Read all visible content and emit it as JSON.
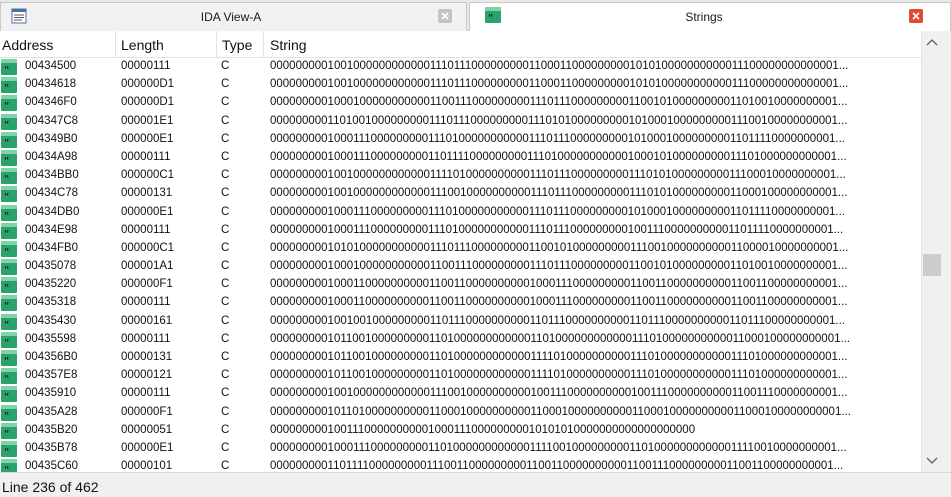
{
  "tabs": [
    {
      "title": "IDA View-A",
      "icon": "text-lines-icon",
      "active": false
    },
    {
      "title": "Strings",
      "icon": "quote-icon",
      "active": true
    }
  ],
  "columns": {
    "address": "Address",
    "length": "Length",
    "type": "Type",
    "string": "String"
  },
  "rows": [
    {
      "address": "00434500",
      "length": "00000111",
      "type": "C",
      "string": "000000000100100000000000011101110000000001100011000000000101010000000000011100000000000001..."
    },
    {
      "address": "00434618",
      "length": "000000D1",
      "type": "C",
      "string": "000000000100100000000000011101110000000001100011000000000101010000000000011100000000000001..."
    },
    {
      "address": "004346F0",
      "length": "000000D1",
      "type": "C",
      "string": "000000000100010000000000011001110000000001110111000000000110010100000000011010010000000001..."
    },
    {
      "address": "004347C8",
      "length": "000001E1",
      "type": "C",
      "string": "000000000110100100000000011101110000000001110101000000000101000100000000011100100000000001..."
    },
    {
      "address": "004349B0",
      "length": "000000E1",
      "type": "C",
      "string": "000000000100011100000000011101000000000001110111000000000101000100000000011011110000000001..."
    },
    {
      "address": "00434A98",
      "length": "00000111",
      "type": "C",
      "string": "000000000100011100000000011011110000000001110100000000000100010100000000011101000000000001..."
    },
    {
      "address": "00434BB0",
      "length": "000000C1",
      "type": "C",
      "string": "000000000100100000000000011110100000000001110111000000000111010100000000011100010000000001..."
    },
    {
      "address": "00434C78",
      "length": "00000131",
      "type": "C",
      "string": "000000000100100000000000011100100000000001110111000000000111010100000000011000100000000001..."
    },
    {
      "address": "00434DB0",
      "length": "000000E1",
      "type": "C",
      "string": "000000000100011100000000011101000000000001110111000000000101000100000000011011110000000001..."
    },
    {
      "address": "00434E98",
      "length": "00000111",
      "type": "C",
      "string": "000000000100011100000000011101000000000001110111000000000100111000000000011011110000000001..."
    },
    {
      "address": "00434FB0",
      "length": "000000C1",
      "type": "C",
      "string": "000000000101010000000000011101110000000001100101000000000111001000000000011000010000000001..."
    },
    {
      "address": "00435078",
      "length": "000001A1",
      "type": "C",
      "string": "000000000100010000000000011001110000000001110111000000000110010100000000011010010000000001..."
    },
    {
      "address": "00435220",
      "length": "000000F1",
      "type": "C",
      "string": "000000000100011000000000011001100000000001000111000000000110011000000000011001100000000001..."
    },
    {
      "address": "00435318",
      "length": "00000111",
      "type": "C",
      "string": "000000000100011000000000011001100000000001000111000000000110011000000000011001100000000001..."
    },
    {
      "address": "00435430",
      "length": "00000161",
      "type": "C",
      "string": "000000000100100100000000011011100000000001101110000000000110111000000000011011100000000001..."
    },
    {
      "address": "00435598",
      "length": "00000111",
      "type": "C",
      "string": "000000000101100100000000011010000000000001101000000000000111010000000000011000100000000001..."
    },
    {
      "address": "004356B0",
      "length": "00000131",
      "type": "C",
      "string": "000000000101100100000000011010000000000001111010000000000111010000000000011101000000000001..."
    },
    {
      "address": "004357E8",
      "length": "00000121",
      "type": "C",
      "string": "000000000101100100000000011010000000000001111010000000000111010000000000011101000000000001..."
    },
    {
      "address": "00435910",
      "length": "00000111",
      "type": "C",
      "string": "000000000100100000000000011100100000000001001110000000000100111000000000011001110000000001..."
    },
    {
      "address": "00435A28",
      "length": "000000F1",
      "type": "C",
      "string": "000000000101101000000000011000100000000001100010000000000110001000000000011000100000000001..."
    },
    {
      "address": "00435B20",
      "length": "00000051",
      "type": "C",
      "string": "0000000001001110000000000100011100000000010101010000000000000000000"
    },
    {
      "address": "00435B78",
      "length": "000000E1",
      "type": "C",
      "string": "000000000100011100000000011010000000000001111001000000000110100000000000011110010000000001..."
    },
    {
      "address": "00435C60",
      "length": "00000101",
      "type": "C",
      "string": "000000000110111100000000011100110000000001100110000000000110011100000000011001100000000001..."
    }
  ],
  "status": {
    "text": "Line 236 of 462"
  },
  "colors": {
    "accent_close": "#e24b2f",
    "row_icon": "#2aa36b"
  }
}
